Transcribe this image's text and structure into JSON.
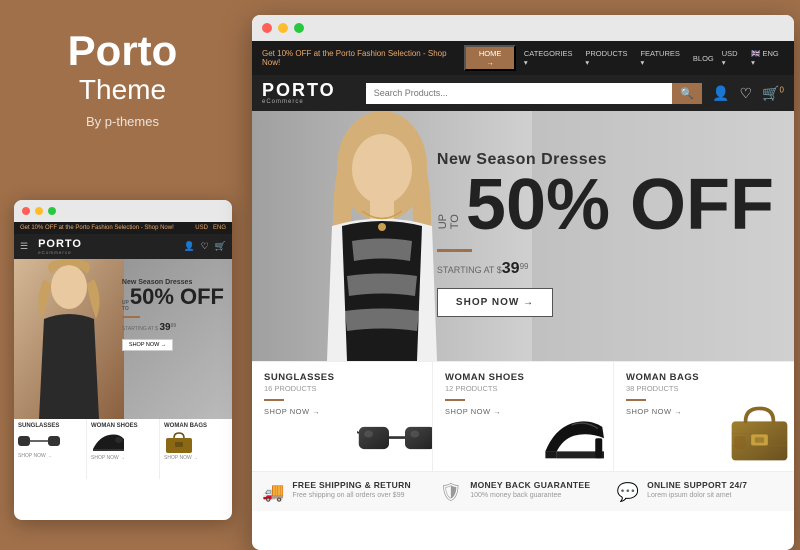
{
  "left": {
    "title": "Porto",
    "subtitle": "Theme",
    "by": "By p-themes"
  },
  "mini_browser": {
    "dots": [
      "red",
      "yellow",
      "green"
    ],
    "topbar": {
      "promo": "Get 10% OFF at the Porto Fashion Selection - ",
      "promo_link": "Shop Now!",
      "currency": "USD",
      "lang": "ENG"
    },
    "logo": "PORTO",
    "hero": {
      "season": "New Season Dresses",
      "upto": "UP TO",
      "off": "50% OFF",
      "starting": "STARTING AT $39",
      "starting_sup": "99",
      "shop": "SHOP NOW →"
    },
    "products": [
      {
        "name": "SUNGLASSES",
        "count": ""
      },
      {
        "name": "WOMAN SHOES",
        "count": ""
      },
      {
        "name": "WOMAN BAGS",
        "count": ""
      }
    ]
  },
  "main_browser": {
    "dots": [
      "red",
      "yellow",
      "green"
    ],
    "topbar": {
      "promo": "Get 10% OFF at the Porto Fashion Selection - ",
      "promo_link": "Shop Now!",
      "nav_items": [
        "HOME →",
        "CATEGORIES ▾",
        "PRODUCTS ▾",
        "FEATURES ▾",
        "BLOG",
        "USD ▾",
        "🇬🇧 ENG ▾"
      ]
    },
    "logo": "PORTO",
    "logo_sub": "eCommerce",
    "search_placeholder": "Search Products...",
    "nav_menu": [
      "HOME →",
      "CATEGORIES ▾",
      "PRODUCTS ▾",
      "FEATURES ▾",
      "BLOG",
      "USD ▾",
      "ENG ▾"
    ],
    "hero": {
      "season": "New Season Dresses",
      "upto": "UP\nTO",
      "off": "50% OFF",
      "starting_label": "STARTING AT $",
      "starting_price": "39",
      "starting_sup": "99",
      "shop": "SHOP NOW →"
    },
    "products": [
      {
        "name": "SUNGLASSES",
        "count": "16 PRODUCTS",
        "shop": "SHOP NOW →"
      },
      {
        "name": "WOMAN SHOES",
        "count": "12 PRODUCTS",
        "shop": "SHOP NOW →"
      },
      {
        "name": "WOMAN BAGS",
        "count": "38 PRODUCTS",
        "shop": "SHOP NOW →"
      }
    ],
    "footer": [
      {
        "icon": "🚚",
        "title": "FREE SHIPPING & RETURN",
        "desc": "Free shipping on all orders over $99"
      },
      {
        "icon": "🛡",
        "title": "MONEY BACK GUARANTEE",
        "desc": "100% money back guarantee"
      },
      {
        "icon": "💬",
        "title": "ONLINE SUPPORT 24/7",
        "desc": "Lorem ipsum dolor sit amet"
      }
    ]
  }
}
